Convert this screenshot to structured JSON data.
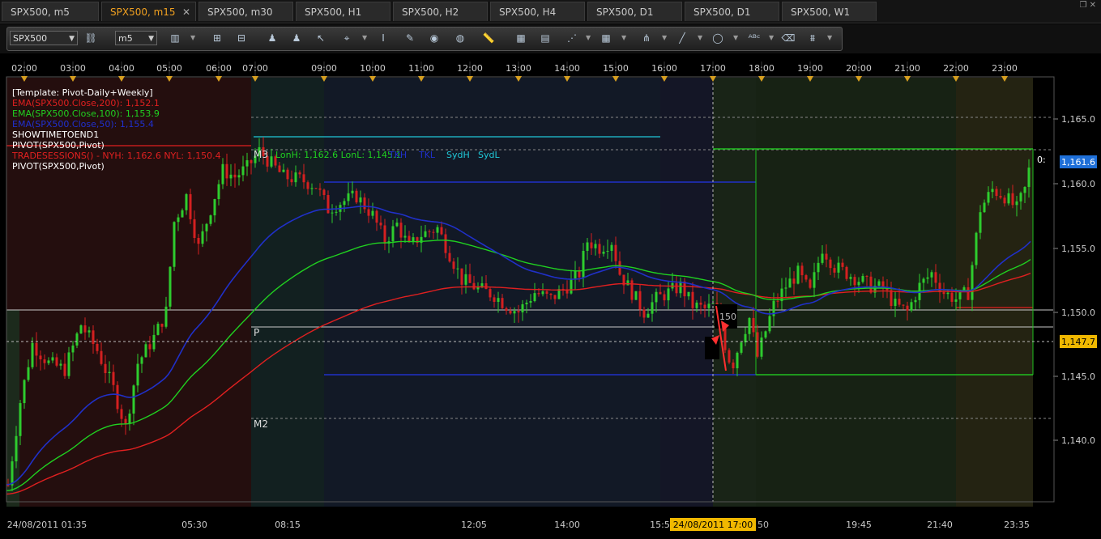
{
  "tabs": [
    {
      "label": "SPX500, m5",
      "active": false
    },
    {
      "label": "SPX500, m15",
      "active": true,
      "close": "✕"
    },
    {
      "label": "SPX500, m30",
      "active": false
    },
    {
      "label": "SPX500, H1",
      "active": false
    },
    {
      "label": "SPX500, H2",
      "active": false
    },
    {
      "label": "SPX500, H4",
      "active": false
    },
    {
      "label": "SPX500, D1",
      "active": false
    },
    {
      "label": "SPX500, D1",
      "active": false
    },
    {
      "label": "SPX500, W1",
      "active": false
    }
  ],
  "toolbar": {
    "symbol": "SPX500",
    "timeframe": "m5"
  },
  "time_axis_top": [
    "02:00",
    "03:00",
    "04:00",
    "05:00",
    "06:00",
    "07:00",
    "09:00",
    "10:00",
    "11:00",
    "12:00",
    "13:00",
    "14:00",
    "15:00",
    "16:00",
    "17:00",
    "18:00",
    "19:00",
    "20:00",
    "21:00",
    "22:00",
    "23:00"
  ],
  "time_axis_bottom": [
    "24/08/2011 01:35",
    "05:30",
    "08:15",
    "12:05",
    "14:00",
    "15:55",
    "19:45",
    "21:40",
    "23:35"
  ],
  "crosshair_time": "24/08/2011 17:00",
  "crosshair_suffix": "50",
  "price_axis": [
    "1,165.0",
    "1,160.0",
    "1,155.0",
    "1,150.0",
    "1,145.0",
    "1,140.0"
  ],
  "price_labels": {
    "current": "1,161.6",
    "crosshair": "1,147.7",
    "current_color": "#1e6fd8",
    "crosshair_color": "#f0b800"
  },
  "indicators": [
    {
      "text": "[Template: Pivot-Daily+Weekly]",
      "color": "#ffffff"
    },
    {
      "text": "EMA(SPX500.Close,200): 1,152.1",
      "color": "#e02020"
    },
    {
      "text": "EMA(SPX500.Close,100): 1,153.9",
      "color": "#20d020"
    },
    {
      "text": "EMA(SPX500.Close,50): 1,155.4",
      "color": "#2030d0"
    },
    {
      "text": "SHOWTIMETOEND1",
      "color": "#ffffff"
    },
    {
      "text": "PIVOT(SPX500,Pivot)",
      "color": "#ffffff"
    },
    {
      "text": "TRADESESSIONS() - NYH: 1,162.6  NYL: 1,150.4",
      "color": "#e02020"
    },
    {
      "text": "PIVOT(SPX500,Pivot)",
      "color": "#ffffff"
    }
  ],
  "session_labels": {
    "lon": "LonH: 1,162.6  LonL: 1,145.1",
    "tkh": "TKH",
    "tkl": "TKL",
    "sydh": "SydH",
    "sydl": "SydL"
  },
  "pivot_labels": {
    "m3": "M3",
    "p": "P",
    "m2": "M2",
    "tag150": "150",
    "right_tag": "0:"
  },
  "colors": {
    "ema200": "#e02020",
    "ema100": "#20d020",
    "ema50": "#2030c8",
    "bull": "#2ecc2e",
    "bear": "#d42020"
  }
}
